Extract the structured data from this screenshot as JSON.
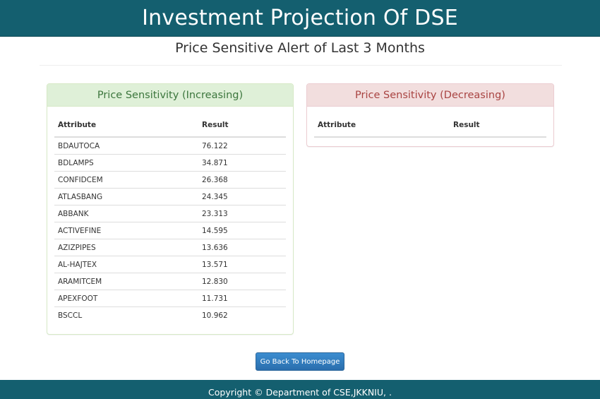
{
  "header": {
    "title": "Investment Projection Of DSE"
  },
  "page": {
    "subtitle": "Price Sensitive Alert of Last 3 Months"
  },
  "increasing": {
    "heading": "Price Sensitivity (Increasing)",
    "columns": [
      "Attribute",
      "Result"
    ],
    "rows": [
      [
        "BDAUTOCA",
        "76.122"
      ],
      [
        "BDLAMPS",
        "34.871"
      ],
      [
        "CONFIDCEM",
        "26.368"
      ],
      [
        "ATLASBANG",
        "24.345"
      ],
      [
        "ABBANK",
        "23.313"
      ],
      [
        "ACTIVEFINE",
        "14.595"
      ],
      [
        "AZIZPIPES",
        "13.636"
      ],
      [
        "AL-HAJTEX",
        "13.571"
      ],
      [
        "ARAMITCEM",
        "12.830"
      ],
      [
        "APEXFOOT",
        "11.731"
      ],
      [
        "BSCCL",
        "10.962"
      ]
    ]
  },
  "decreasing": {
    "heading": "Price Sensitivity (Decreasing)",
    "columns": [
      "Attribute",
      "Result"
    ],
    "rows": []
  },
  "actions": {
    "back_label": "Go Back To Homepage"
  },
  "footer": {
    "copyright": "Copyright © Department of CSE,JKKNIU, ."
  },
  "colors": {
    "brand": "#145f6f",
    "success_bg": "#dff0d8",
    "success_text": "#3c763d",
    "danger_bg": "#f2dede",
    "danger_text": "#a94442",
    "button": "#337ab7"
  }
}
